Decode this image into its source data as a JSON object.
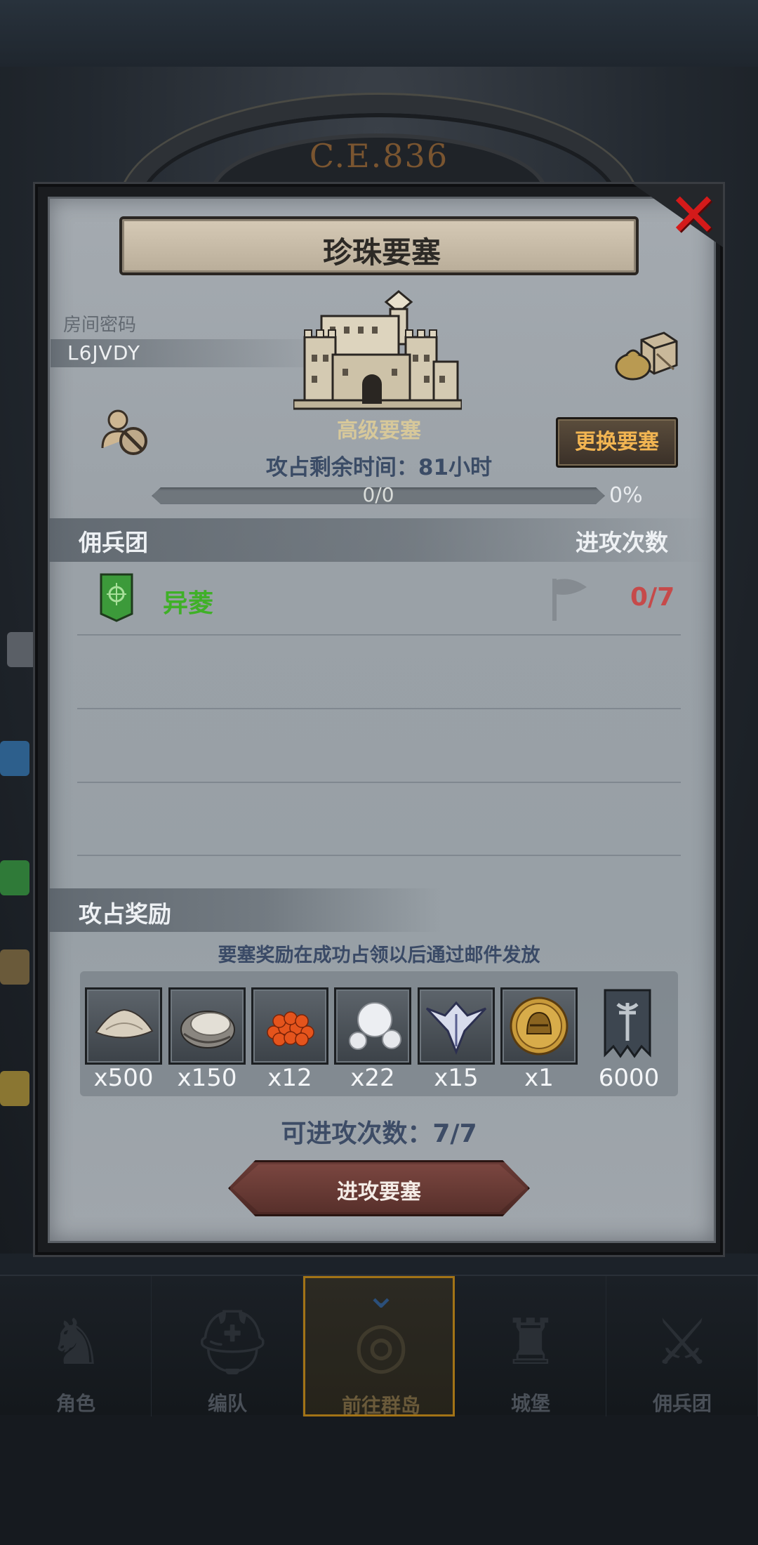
{
  "background": {
    "era_label": "C.E.836"
  },
  "dialog": {
    "title": "珍珠要塞",
    "room_password_label": "房间密码",
    "room_password_value": "L6JVDY",
    "fortress_level": "高级要塞",
    "change_fortress_label": "更换要塞",
    "occupy_time_label": "攻占剩余时间：",
    "occupy_time_value": "81小时",
    "progress": {
      "text": "0/0",
      "percent_label": "0%",
      "fraction": 0
    },
    "mercenary_section": {
      "title": "佣兵团",
      "attack_count_header": "进攻次数",
      "teams": [
        {
          "name": "异菱",
          "attack_count": "0/7",
          "emblem_color": "#3c9a3a"
        }
      ]
    },
    "reward_section": {
      "title": "攻占奖励",
      "note": "要塞奖励在成功占领以后通过邮件发放",
      "items": [
        {
          "icon": "flour-sack-icon",
          "qty": "x500"
        },
        {
          "icon": "oyster-icon",
          "qty": "x150"
        },
        {
          "icon": "fish-roe-icon",
          "qty": "x12"
        },
        {
          "icon": "pearls-icon",
          "qty": "x22"
        },
        {
          "icon": "winged-emblem-icon",
          "qty": "x15"
        },
        {
          "icon": "gold-helmet-coin-icon",
          "qty": "x1"
        },
        {
          "icon": "guild-banner-icon",
          "qty": "6000"
        }
      ]
    },
    "attempts_label": "可进攻次数：",
    "attempts_value": "7/7",
    "attack_button_label": "进攻要塞"
  },
  "nav": {
    "items": [
      {
        "label": "角色",
        "icon": "knight-icon",
        "active": false
      },
      {
        "label": "编队",
        "icon": "helmet-icon",
        "active": false
      },
      {
        "label": "前往群岛",
        "icon": "globe-compass-icon",
        "active": true
      },
      {
        "label": "城堡",
        "icon": "castle-icon",
        "active": false
      },
      {
        "label": "佣兵团",
        "icon": "mercenary-icon",
        "active": false
      }
    ]
  },
  "colors": {
    "accent_gold": "#f2b552",
    "team_green": "#3fb027",
    "count_red": "#c64a4a",
    "close_red": "#d41a1a"
  }
}
